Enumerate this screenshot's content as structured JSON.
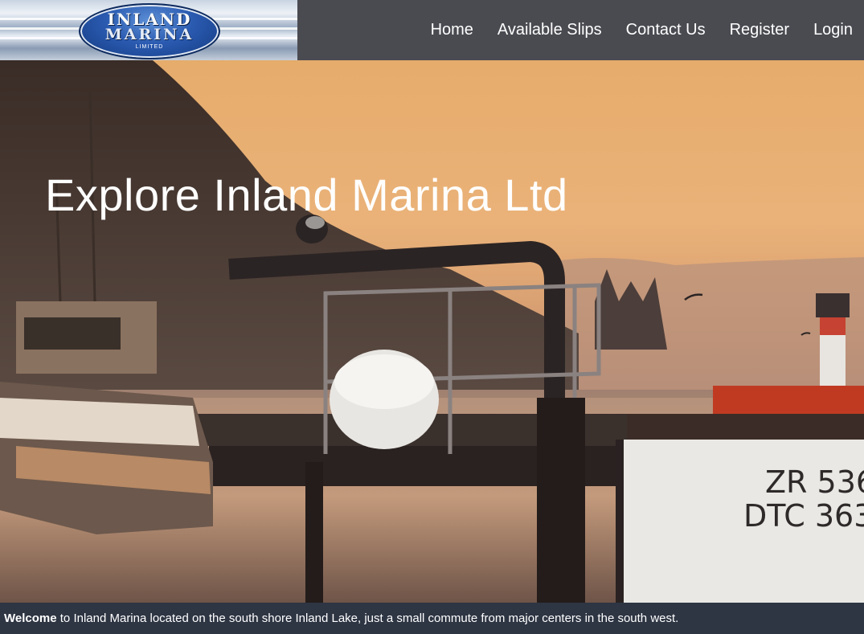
{
  "logo": {
    "line1": "INLAND",
    "line2": "MARINA",
    "line3": "LIMITED"
  },
  "nav": {
    "items": [
      {
        "label": "Home"
      },
      {
        "label": "Available Slips"
      },
      {
        "label": "Contact Us"
      },
      {
        "label": "Register"
      },
      {
        "label": "Login"
      }
    ]
  },
  "hero": {
    "title": "Explore Inland Marina Ltd",
    "boat_registration_line1": "ZR 536",
    "boat_registration_line2": "DTC 363"
  },
  "welcome": {
    "bold": "Welcome",
    "text": " to Inland Marina located on the south shore Inland Lake, just a small commute from major centers in the south west."
  }
}
